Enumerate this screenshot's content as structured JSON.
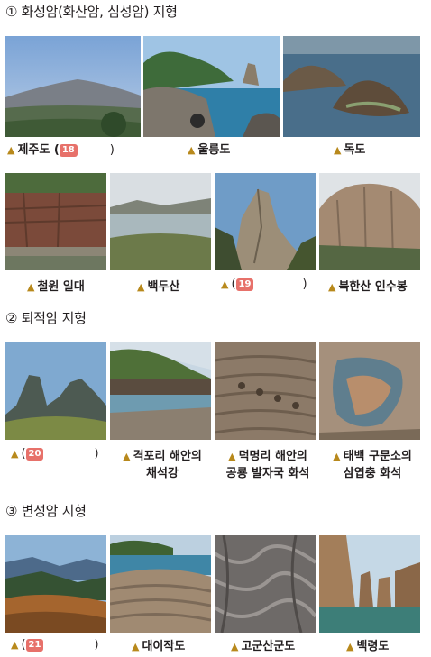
{
  "sections": [
    {
      "marker": "①",
      "title": "화성암(화산암, 심성암) 지형"
    },
    {
      "marker": "②",
      "title": "퇴적암 지형"
    },
    {
      "marker": "③",
      "title": "변성암 지형"
    }
  ],
  "triangle": "▲",
  "captions": {
    "jeju": {
      "text": "제주도 (",
      "badge": "18",
      "close": ")"
    },
    "ulleung": {
      "text": "울릉도"
    },
    "dokdo": {
      "text": "독도"
    },
    "cheorwon": {
      "text": "철원 일대"
    },
    "baekdu": {
      "text": "백두산"
    },
    "q19": {
      "open": "(",
      "badge": "19",
      "close": ")"
    },
    "bukhan": {
      "text": "북한산 인수봉"
    },
    "q20": {
      "open": "(",
      "badge": "20",
      "close": ")"
    },
    "gyeokpo": {
      "line1": "격포리 해안의",
      "line2": "채석강"
    },
    "deokmyeong": {
      "line1": "덕명리 해안의",
      "line2": "공룡 발자국 화석"
    },
    "taebaek": {
      "line1": "태백 구문소의",
      "line2": "삼엽충 화석"
    },
    "q21": {
      "open": "(",
      "badge": "21",
      "close": ")"
    },
    "daeijak": {
      "text": "대이작도"
    },
    "gogunsan": {
      "text": "고군산군도"
    },
    "baengnyeong": {
      "text": "백령도"
    }
  }
}
